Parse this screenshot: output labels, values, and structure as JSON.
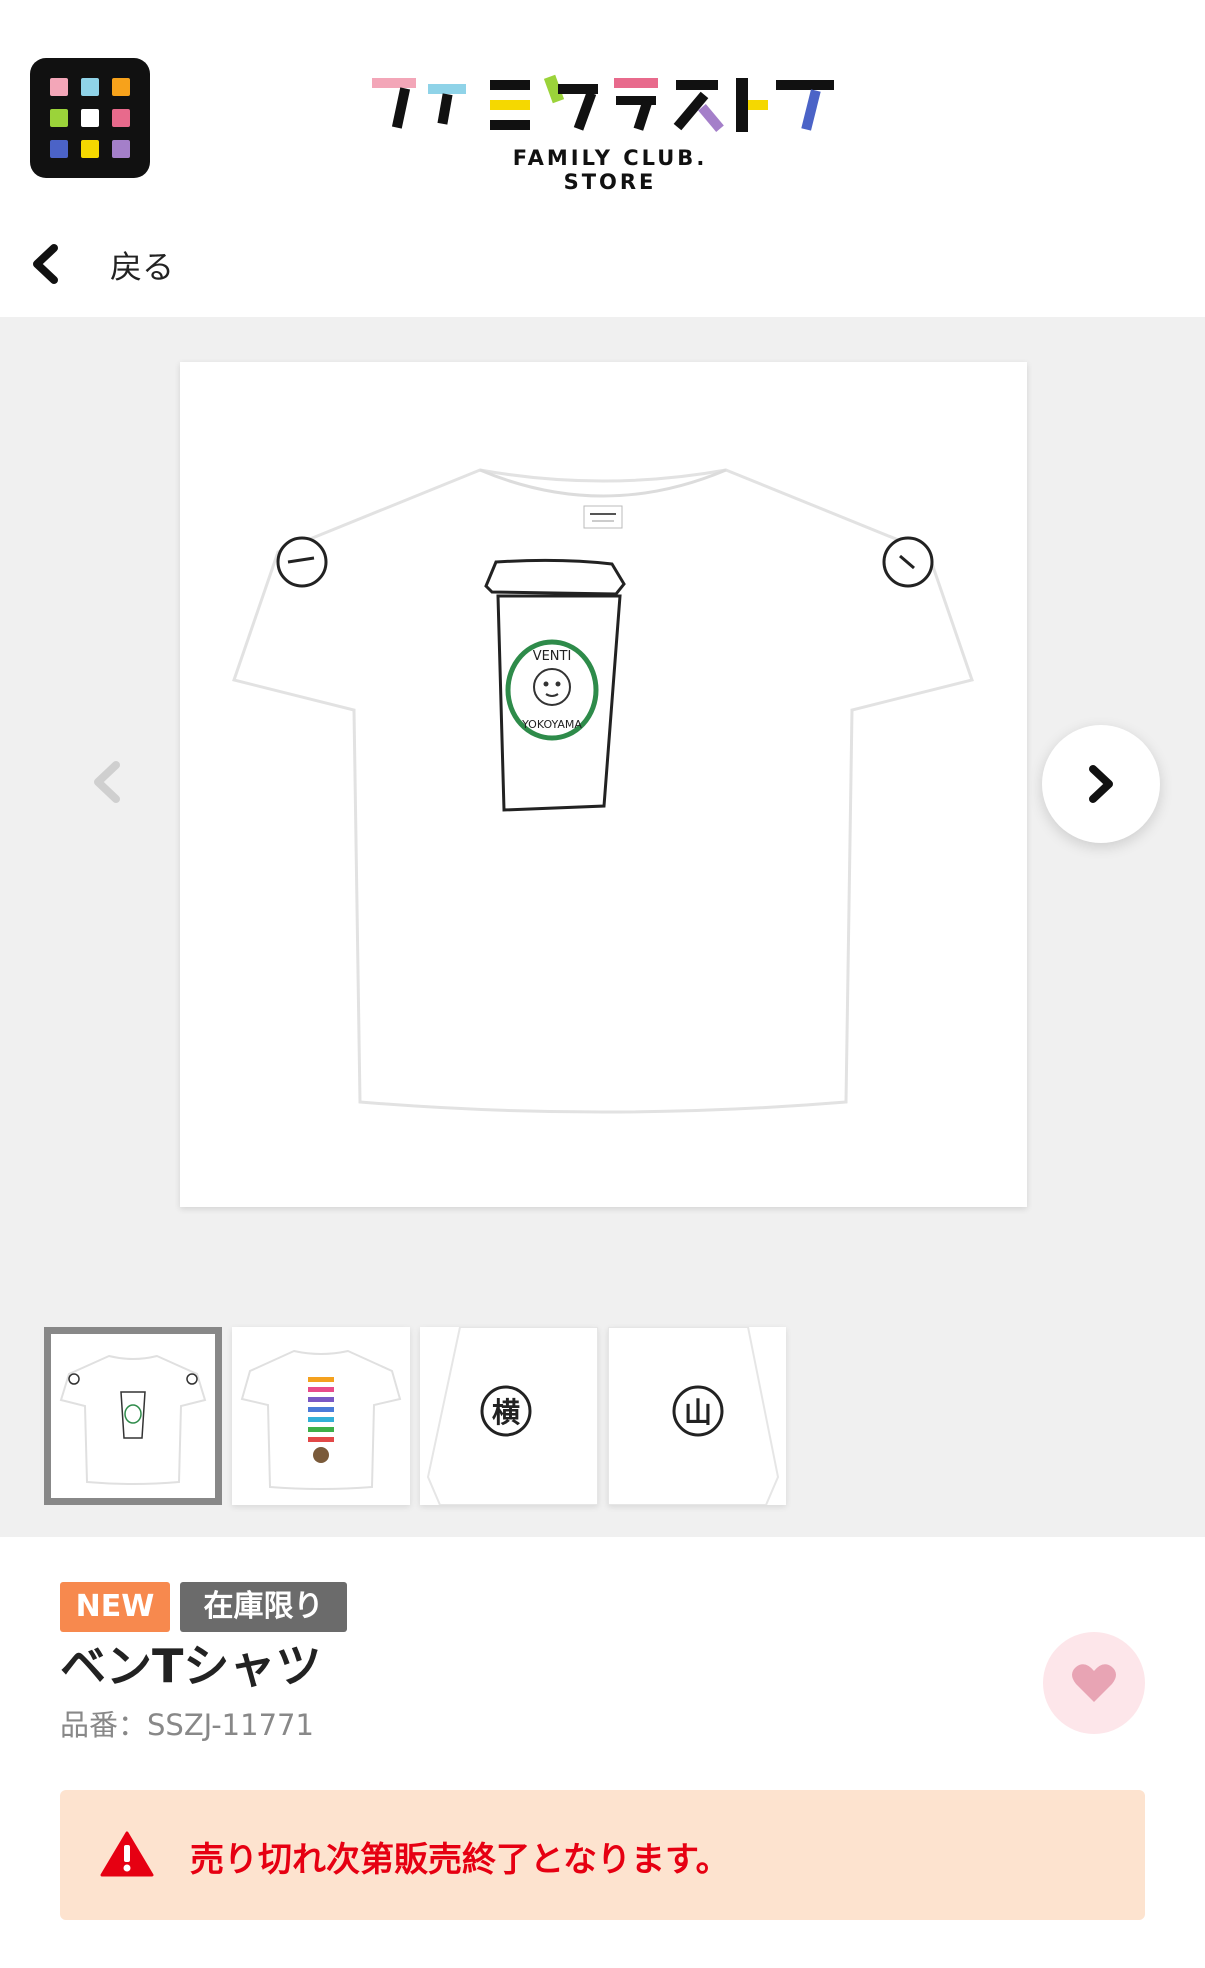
{
  "header": {
    "logo_text": "ファミクラストア",
    "logo_subtitle": "FAMILY CLUB. STORE",
    "menu_icon": "grid-menu-icon",
    "icon_colors": [
      "#f3a6b8",
      "#8fd3e8",
      "#f7a21b",
      "#9bd33a",
      "#ffffff",
      "#e86a8c",
      "#4b63c7",
      "#f5d800",
      "#a47fc9"
    ]
  },
  "nav": {
    "back_label": "戻る"
  },
  "gallery": {
    "image_alt": "ベンTシャツ",
    "print_top": "VENTI",
    "print_bottom": "YOKOYAMA",
    "thumbnails": [
      {
        "kind": "front",
        "selected": true
      },
      {
        "kind": "back",
        "selected": false
      },
      {
        "kind": "sleeve",
        "label": "横",
        "selected": false
      },
      {
        "kind": "sleeve",
        "label": "山",
        "selected": false
      }
    ]
  },
  "product": {
    "badge_new": "NEW",
    "badge_stock": "在庫限り",
    "title": "ベンTシャツ",
    "code": "品番：SSZJ-11771",
    "favorite_icon": "heart-icon"
  },
  "notice": {
    "icon": "warning-icon",
    "text": "売り切れ次第販売終了となります。"
  },
  "colors": {
    "new_badge": "#f7894e",
    "stock_badge": "#6b6b6b",
    "notice_bg": "#fde3cf",
    "notice_text": "#e60012",
    "favorite_bg": "#fde6ea",
    "favorite_heart": "#e8a4b4"
  }
}
